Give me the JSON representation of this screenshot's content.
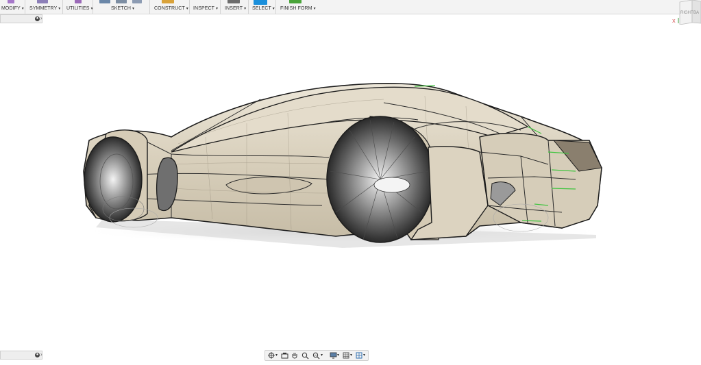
{
  "toolbar": {
    "groups": [
      {
        "label": "MODIFY"
      },
      {
        "label": "SYMMETRY"
      },
      {
        "label": "UTILITIES"
      },
      {
        "label": "SKETCH"
      },
      {
        "label": "CONSTRUCT"
      },
      {
        "label": "INSPECT"
      },
      {
        "label": "INSERT"
      },
      {
        "label": "SELECT"
      },
      {
        "label": "FINISH FORM"
      }
    ]
  },
  "viewcube": {
    "face_right": "RIGHT",
    "face_back": "BA",
    "axis_x": "X"
  },
  "colors": {
    "accent_select": "#1a8fdb",
    "finish_form": "#4aa43a",
    "body_surface": "#dcd3c0",
    "edge_highlight": "#3fc43f"
  }
}
